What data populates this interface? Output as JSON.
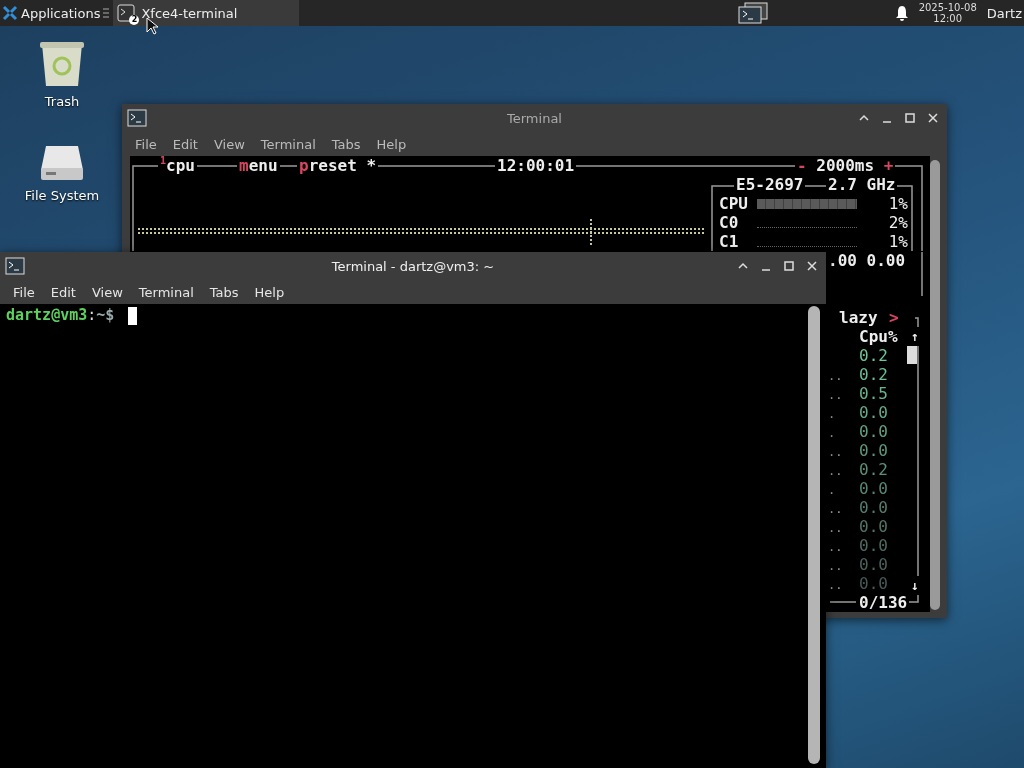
{
  "panel": {
    "apps_label": "Applications",
    "task": {
      "label": "Xfce4-terminal",
      "badge": "2",
      "selected": true
    },
    "date": "2025-10-08",
    "time": "12:00",
    "user": "Dartz"
  },
  "desktop_icons": [
    {
      "kind": "trash",
      "label": "Trash"
    },
    {
      "kind": "drive",
      "label": "File System"
    }
  ],
  "back_window": {
    "title": "Terminal",
    "active": false,
    "menu": [
      "File",
      "Edit",
      "View",
      "Terminal",
      "Tabs",
      "Help"
    ],
    "btop": {
      "tabs": [
        {
          "sup": "1",
          "text": "cpu"
        },
        {
          "hot": "m",
          "text": "enu"
        },
        {
          "hot": "p",
          "text": "reset *"
        }
      ],
      "clock": "12:00:01",
      "interval": {
        "minus": "-",
        "value": "2000ms",
        "plus": "+"
      },
      "cpu_model": "E5-2697",
      "cpu_freq": "2.7 GHz",
      "cores": [
        {
          "label": "CPU",
          "percent": "1%"
        },
        {
          "label": "C0",
          "percent": "2%"
        },
        {
          "label": "C1",
          "percent": "1%"
        }
      ],
      "load": ".00 0.00",
      "proc": {
        "sort": "lazy",
        "arrow": ">",
        "column": "Cpu%",
        "up": "↑",
        "down": "↓",
        "count": "0/136",
        "rows": [
          {
            "value": "0.2"
          },
          {
            "lead": "..",
            "value": "0.2"
          },
          {
            "lead": "..",
            "value": "0.5"
          },
          {
            "lead": ".",
            "value": "0.0"
          },
          {
            "lead": ".",
            "value": "0.0"
          },
          {
            "lead": "..",
            "value": "0.0"
          },
          {
            "lead": "..",
            "value": "0.2"
          },
          {
            "lead": ".",
            "value": "0.0"
          },
          {
            "lead": "..",
            "value": "0.0"
          },
          {
            "lead": "..",
            "value": "0.0"
          },
          {
            "lead": "..",
            "value": "0.0"
          },
          {
            "lead": "..",
            "value": "0.0"
          },
          {
            "lead": "..",
            "value": "0.0"
          }
        ]
      }
    }
  },
  "front_window": {
    "title": "Terminal - dartz@vm3: ~",
    "active": true,
    "menu": [
      "File",
      "Edit",
      "View",
      "Terminal",
      "Tabs",
      "Help"
    ],
    "prompt": {
      "user_host": "dartz@vm3",
      "sep": ":",
      "path": "~$"
    }
  }
}
